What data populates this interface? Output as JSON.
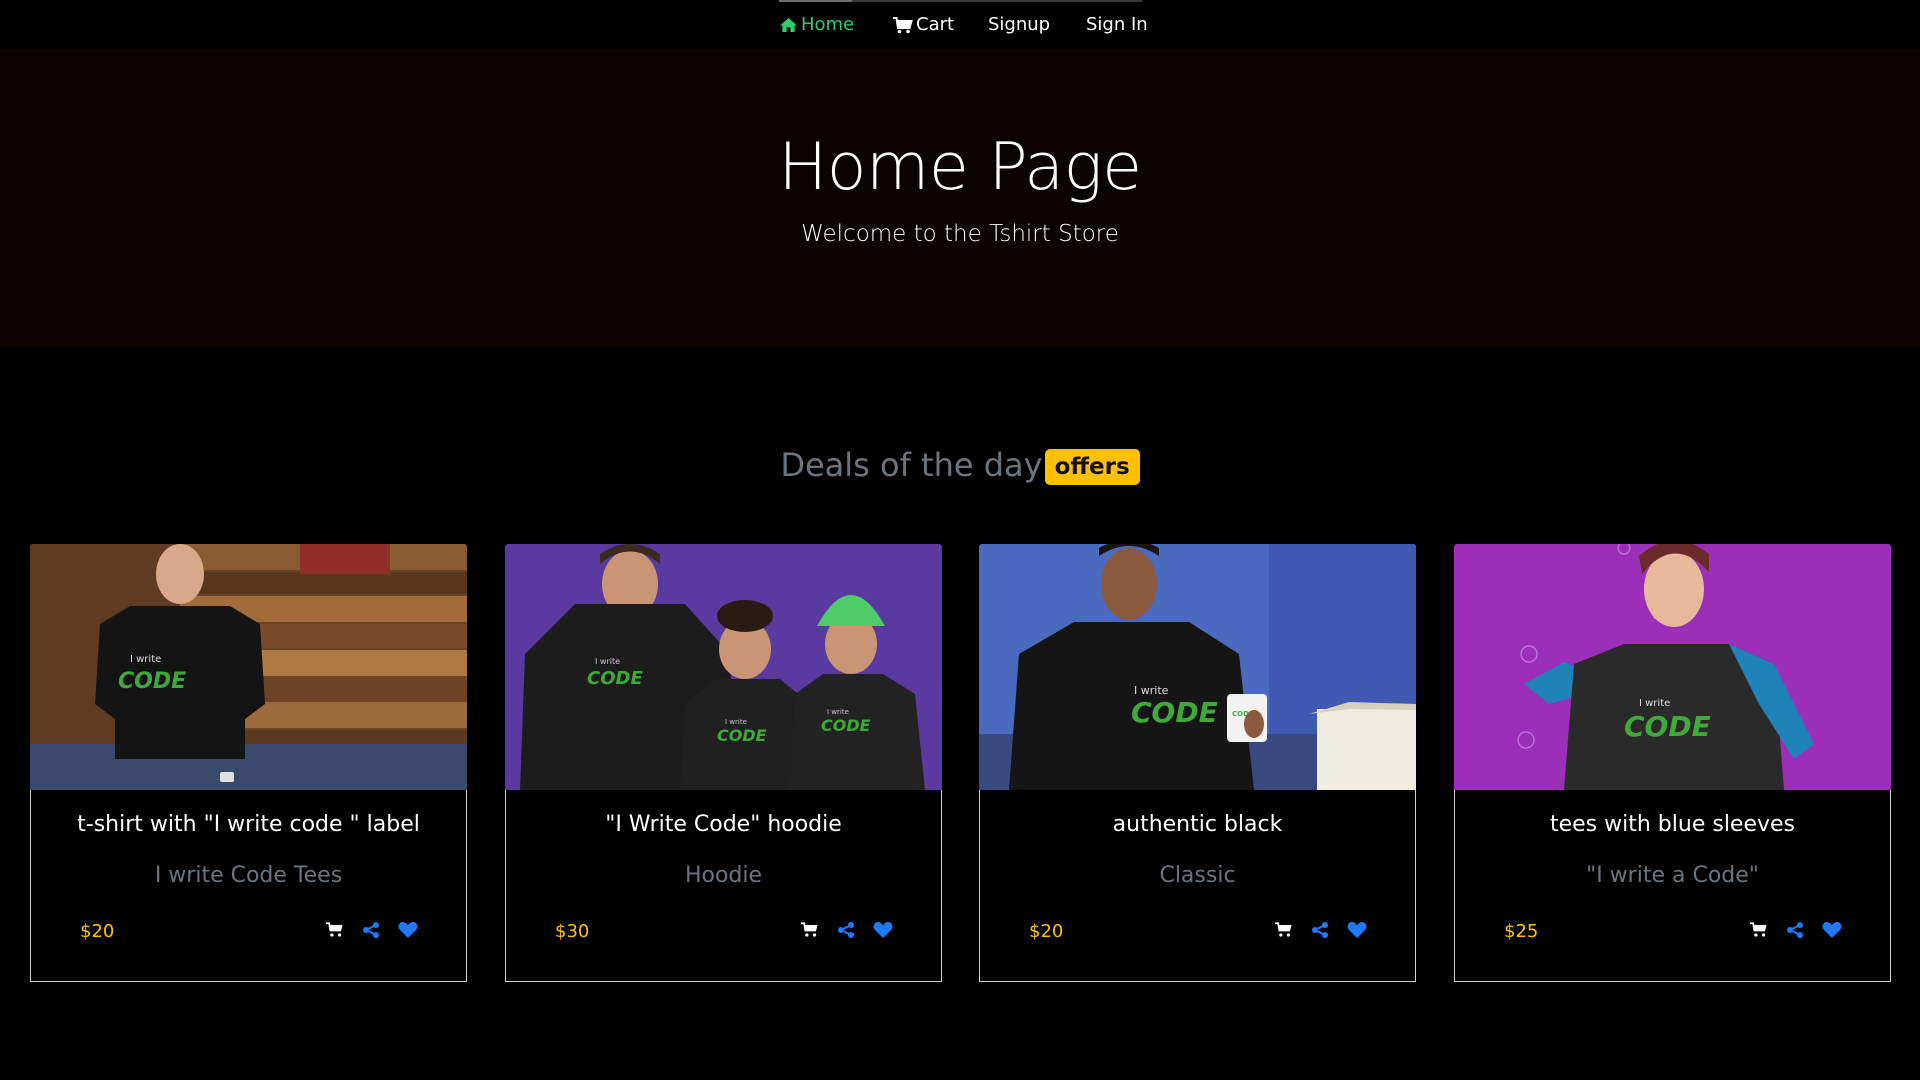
{
  "nav": {
    "items": [
      {
        "label": "Home",
        "icon": "home-icon",
        "active": true
      },
      {
        "label": "Cart",
        "icon": "cart-icon"
      },
      {
        "label": "Signup"
      },
      {
        "label": "Sign In"
      }
    ]
  },
  "hero": {
    "title": "Home Page",
    "subtitle": "Welcome to the Tshirt Store"
  },
  "deals": {
    "heading": "Deals of the day",
    "badge": "offers"
  },
  "products": [
    {
      "title": "t-shirt with \"I write code \" label",
      "subtitle": "I write Code Tees",
      "price": "$20",
      "image_text_1": "I write",
      "image_text_2": "CODE"
    },
    {
      "title": "\"I Write Code\" hoodie",
      "subtitle": "Hoodie",
      "price": "$30",
      "image_text_1": "I write",
      "image_text_2": "CODE"
    },
    {
      "title": "authentic black",
      "subtitle": "Classic",
      "price": "$20",
      "image_text_1": "I write",
      "image_text_2": "CODE"
    },
    {
      "title": "tees with blue sleeves",
      "subtitle": "\"I write a Code\"",
      "price": "$25",
      "image_text_1": "I write",
      "image_text_2": "CODE"
    }
  ],
  "colors": {
    "nav_active": "#2ecc71",
    "price": "#ffc107",
    "badge": "#ffc107",
    "action_blue": "#1e7bff",
    "muted": "#6c757d",
    "hero_bg": "#0b0202",
    "page_bg": "#000000"
  },
  "action_icons": [
    "cart-icon",
    "share-icon",
    "heart-icon"
  ]
}
